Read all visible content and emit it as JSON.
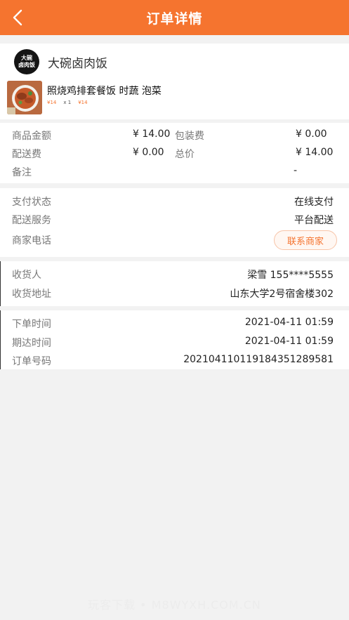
{
  "header": {
    "title": "订单详情"
  },
  "shop": {
    "name": "大碗卤肉饭",
    "logo_line1": "大碗",
    "logo_line2": "卤肉饭"
  },
  "item": {
    "name": "照烧鸡排套餐饭 时蔬 泡菜",
    "unit_price": "¥14",
    "quantity": "x 1",
    "total_price": "¥14"
  },
  "fees": {
    "goods_amount_label": "商品金额",
    "goods_amount_value": "¥ 14.00",
    "packing_fee_label": "包装费",
    "packing_fee_value": "¥ 0.00",
    "delivery_fee_label": "配送费",
    "delivery_fee_value": "¥ 0.00",
    "total_label": "总价",
    "total_value": "¥ 14.00",
    "remark_label": "备注",
    "remark_value": "-"
  },
  "payment": {
    "status_label": "支付状态",
    "status_value": "在线支付",
    "delivery_service_label": "配送服务",
    "delivery_service_value": "平台配送",
    "merchant_phone_label": "商家电话",
    "contact_button": "联系商家"
  },
  "recipient": {
    "name_label": "收货人",
    "name_value": "梁雪 155****5555",
    "address_label": "收货地址",
    "address_value": "山东大学2号宿舍楼302"
  },
  "order": {
    "order_time_label": "下单时间",
    "order_time_value": "2021-04-11 01:59",
    "expected_time_label": "期达时间",
    "expected_time_value": "2021-04-11 01:59",
    "order_no_label": "订单号码",
    "order_no_value": "20210411011918435128958​1"
  },
  "watermark": "玩客下载 • M8WYXH.COM.CN",
  "colors": {
    "accent": "#f5742f",
    "background": "#f2f2f2"
  }
}
